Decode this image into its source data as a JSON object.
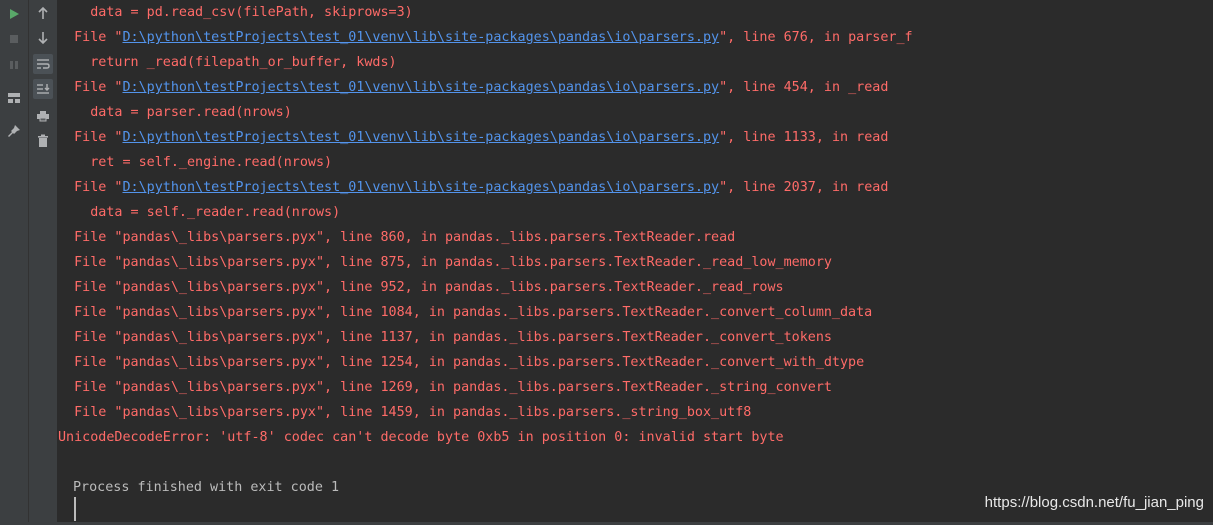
{
  "toolbar_left": {
    "run_icon": "play-icon",
    "stop_icon": "stop-icon",
    "pause_icon": "pause-icon",
    "layout_icon": "layout-icon",
    "pin_icon": "pin-icon"
  },
  "toolbar_right": {
    "up_icon": "arrow-up-icon",
    "down_icon": "arrow-down-icon",
    "wrap_icon": "soft-wrap-icon",
    "scroll_icon": "scroll-to-end-icon",
    "print_icon": "print-icon",
    "trash_icon": "trash-icon"
  },
  "colors": {
    "error": "#ff6b68",
    "link": "#5394ec",
    "normal": "#bbbbbb",
    "background": "#2b2b2b"
  },
  "console": {
    "lines": [
      {
        "pre": "    data = pd.read_csv(filePath, skiprows=3)",
        "link": "",
        "post": ""
      },
      {
        "pre": "  File \"",
        "link": "D:\\python\\testProjects\\test_01\\venv\\lib\\site-packages\\pandas\\io\\parsers.py",
        "post": "\", line 676, in parser_f"
      },
      {
        "pre": "    return _read(filepath_or_buffer, kwds)",
        "link": "",
        "post": ""
      },
      {
        "pre": "  File \"",
        "link": "D:\\python\\testProjects\\test_01\\venv\\lib\\site-packages\\pandas\\io\\parsers.py",
        "post": "\", line 454, in _read"
      },
      {
        "pre": "    data = parser.read(nrows)",
        "link": "",
        "post": ""
      },
      {
        "pre": "  File \"",
        "link": "D:\\python\\testProjects\\test_01\\venv\\lib\\site-packages\\pandas\\io\\parsers.py",
        "post": "\", line 1133, in read"
      },
      {
        "pre": "    ret = self._engine.read(nrows)",
        "link": "",
        "post": ""
      },
      {
        "pre": "  File \"",
        "link": "D:\\python\\testProjects\\test_01\\venv\\lib\\site-packages\\pandas\\io\\parsers.py",
        "post": "\", line 2037, in read"
      },
      {
        "pre": "    data = self._reader.read(nrows)",
        "link": "",
        "post": ""
      },
      {
        "pre": "  File \"pandas\\_libs\\parsers.pyx\", line 860, in pandas._libs.parsers.TextReader.read",
        "link": "",
        "post": ""
      },
      {
        "pre": "  File \"pandas\\_libs\\parsers.pyx\", line 875, in pandas._libs.parsers.TextReader._read_low_memory",
        "link": "",
        "post": ""
      },
      {
        "pre": "  File \"pandas\\_libs\\parsers.pyx\", line 952, in pandas._libs.parsers.TextReader._read_rows",
        "link": "",
        "post": ""
      },
      {
        "pre": "  File \"pandas\\_libs\\parsers.pyx\", line 1084, in pandas._libs.parsers.TextReader._convert_column_data",
        "link": "",
        "post": ""
      },
      {
        "pre": "  File \"pandas\\_libs\\parsers.pyx\", line 1137, in pandas._libs.parsers.TextReader._convert_tokens",
        "link": "",
        "post": ""
      },
      {
        "pre": "  File \"pandas\\_libs\\parsers.pyx\", line 1254, in pandas._libs.parsers.TextReader._convert_with_dtype",
        "link": "",
        "post": ""
      },
      {
        "pre": "  File \"pandas\\_libs\\parsers.pyx\", line 1269, in pandas._libs.parsers.TextReader._string_convert",
        "link": "",
        "post": ""
      },
      {
        "pre": "  File \"pandas\\_libs\\parsers.pyx\", line 1459, in pandas._libs.parsers._string_box_utf8",
        "link": "",
        "post": ""
      },
      {
        "pre": "UnicodeDecodeError: 'utf-8' codec can't decode byte 0xb5 in position 0: invalid start byte",
        "link": "",
        "post": ""
      }
    ],
    "exit_message": "Process finished with exit code 1"
  },
  "watermark": "https://blog.csdn.net/fu_jian_ping"
}
